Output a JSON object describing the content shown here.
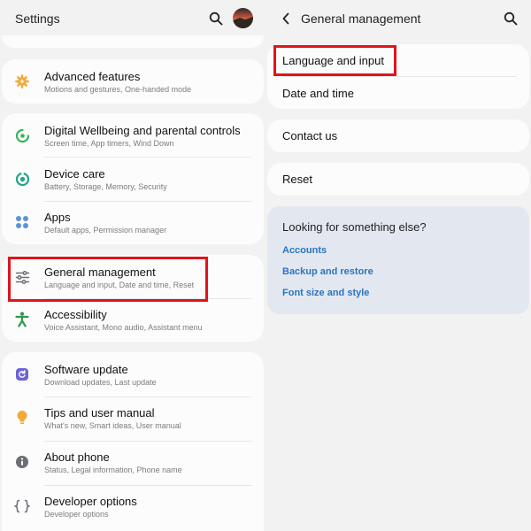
{
  "settings_screen": {
    "title": "Settings",
    "icons": {
      "search": "search-icon",
      "avatar": "avatar"
    },
    "groups": [
      {
        "items": [
          {
            "title": "Advanced features",
            "subtitle": "Motions and gestures, One-handed mode",
            "icon": "gear-plus-icon",
            "icon_color": "#f2a93b"
          }
        ]
      },
      {
        "items": [
          {
            "title": "Digital Wellbeing and parental controls",
            "subtitle": "Screen time, App timers, Wind Down",
            "icon": "wellbeing-icon",
            "icon_color": "#35b45a"
          },
          {
            "title": "Device care",
            "subtitle": "Battery, Storage, Memory, Security",
            "icon": "device-care-icon",
            "icon_color": "#1fa589"
          },
          {
            "title": "Apps",
            "subtitle": "Default apps, Permission manager",
            "icon": "apps-grid-icon",
            "icon_color": "#5a93d8"
          }
        ]
      },
      {
        "items": [
          {
            "title": "General management",
            "subtitle": "Language and input, Date and time, Reset",
            "icon": "sliders-icon",
            "icon_color": "#6b6f76"
          },
          {
            "title": "Accessibility",
            "subtitle": "Voice Assistant, Mono audio, Assistant menu",
            "icon": "accessibility-icon",
            "icon_color": "#2e9b4a"
          }
        ]
      },
      {
        "items": [
          {
            "title": "Software update",
            "subtitle": "Download updates, Last update",
            "icon": "software-update-icon",
            "icon_color": "#6b63d6"
          },
          {
            "title": "Tips and user manual",
            "subtitle": "What's new, Smart ideas, User manual",
            "icon": "lightbulb-icon",
            "icon_color": "#f2a93b"
          },
          {
            "title": "About phone",
            "subtitle": "Status, Legal information, Phone name",
            "icon": "info-icon",
            "icon_color": "#6b6f76"
          },
          {
            "title": "Developer options",
            "subtitle": "Developer options",
            "icon": "braces-icon",
            "icon_color": "#6b6f76"
          }
        ]
      }
    ]
  },
  "general_management_screen": {
    "title": "General management",
    "icons": {
      "back": "back-arrow-icon",
      "search": "search-icon"
    },
    "items": [
      {
        "title": "Language and input"
      },
      {
        "title": "Date and time"
      },
      {
        "title": "Contact us"
      },
      {
        "title": "Reset"
      }
    ],
    "suggestions": {
      "heading": "Looking for something else?",
      "links": [
        "Accounts",
        "Backup and restore",
        "Font size and style"
      ]
    }
  },
  "colors": {
    "highlight": "#e0141b",
    "link": "#2b74c0",
    "background": "#f2f2f2",
    "card": "#fcfcfc",
    "suggest_card": "#e3e8f0"
  }
}
